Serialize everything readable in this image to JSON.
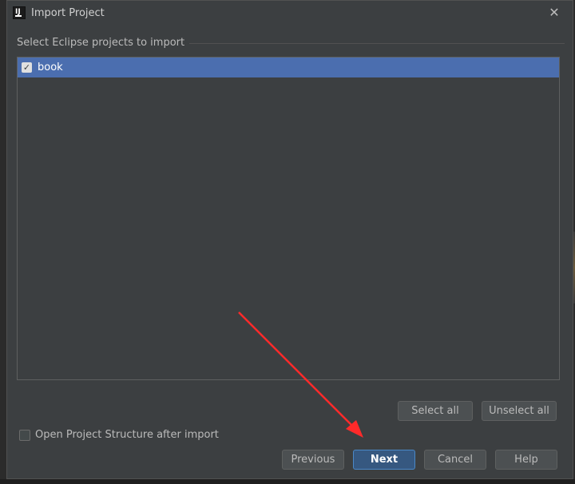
{
  "dialog": {
    "title": "Import Project",
    "app_icon_letter": "IJ",
    "close_glyph": "✕"
  },
  "section": {
    "label": "Select Eclipse projects to import"
  },
  "projects": [
    {
      "name": "book",
      "checked": true,
      "selected": true
    }
  ],
  "list_actions": {
    "select_all_label": "Select all",
    "unselect_all_label": "Unselect all"
  },
  "options": {
    "open_structure_label": "Open Project Structure after import",
    "open_structure_checked": false
  },
  "footer": {
    "previous_label": "Previous",
    "next_label": "Next",
    "cancel_label": "Cancel",
    "help_label": "Help"
  },
  "colors": {
    "dialog_bg": "#3c3f41",
    "selection": "#4b6eaf",
    "primary_button": "#365880",
    "annotation_arrow": "#ff2a2a"
  }
}
